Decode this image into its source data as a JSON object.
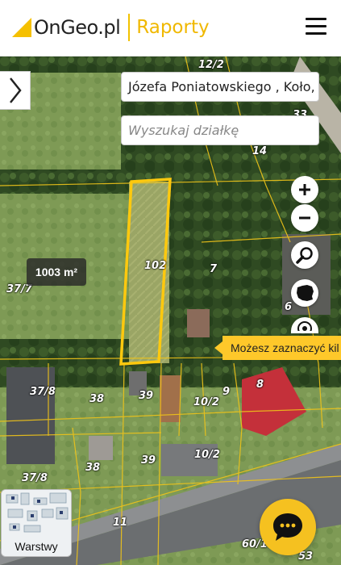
{
  "header": {
    "brand": "OnGeo.pl",
    "section": "Raporty"
  },
  "search": {
    "address_value": "Józefa Poniatowskiego , Koło, g",
    "parcel_placeholder": "Wyszukaj działkę"
  },
  "map": {
    "area_badge": "1003 m²",
    "tooltip": "Możesz zaznaczyć kil",
    "layers_label": "Warstwy",
    "parcel_labels": [
      {
        "id": "p1",
        "text": "12/2"
      },
      {
        "id": "p2",
        "text": "33"
      },
      {
        "id": "p3",
        "text": "14"
      },
      {
        "id": "p4",
        "text": "102"
      },
      {
        "id": "p5",
        "text": "7"
      },
      {
        "id": "p6",
        "text": "6"
      },
      {
        "id": "p7",
        "text": "37/7"
      },
      {
        "id": "p8",
        "text": "37/8"
      },
      {
        "id": "p9",
        "text": "38"
      },
      {
        "id": "p10",
        "text": "39"
      },
      {
        "id": "p11",
        "text": "10/2"
      },
      {
        "id": "p12",
        "text": "9"
      },
      {
        "id": "p13",
        "text": "8"
      },
      {
        "id": "p14",
        "text": "38"
      },
      {
        "id": "p15",
        "text": "39"
      },
      {
        "id": "p16",
        "text": "10/2"
      },
      {
        "id": "p17",
        "text": "37/8"
      },
      {
        "id": "p18",
        "text": "11"
      },
      {
        "id": "p19",
        "text": "60/1"
      },
      {
        "id": "p20",
        "text": "53"
      }
    ],
    "highlight_color": "#ffc90e"
  },
  "icons": {
    "panel_toggle": "chevron-right-icon",
    "zoom_in": "plus-icon",
    "zoom_out": "minus-icon",
    "search": "magnifier-icon",
    "country": "poland-map-icon",
    "chat": "chat-bubble-icon"
  }
}
